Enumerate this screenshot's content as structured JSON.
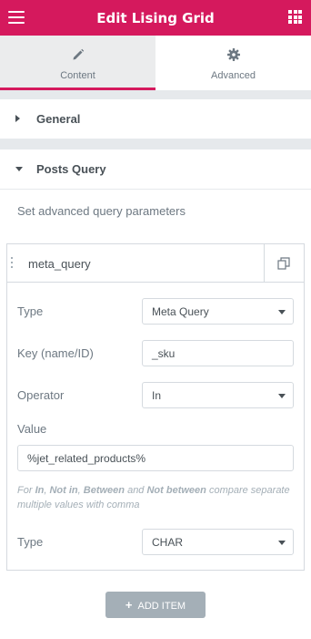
{
  "header": {
    "title": "Edit Lising Grid",
    "menu_icon": "hamburger-menu-icon",
    "apps_icon": "grid-apps-icon",
    "accent_color": "#d5195d"
  },
  "tabs": [
    {
      "label": "Content",
      "icon": "pencil-icon",
      "active": true
    },
    {
      "label": "Advanced",
      "icon": "gear-icon",
      "active": false
    }
  ],
  "sections": {
    "general": {
      "label": "General",
      "expanded": false
    },
    "posts_query": {
      "label": "Posts Query",
      "expanded": true
    }
  },
  "description": "Set advanced query parameters",
  "repeater_item": {
    "title": "meta_query",
    "fields": {
      "type": {
        "label": "Type",
        "value": "Meta Query"
      },
      "key": {
        "label": "Key (name/ID)",
        "value": "_sku"
      },
      "operator": {
        "label": "Operator",
        "value": "In"
      },
      "value": {
        "label": "Value",
        "value": "%jet_related_products%"
      },
      "hint": {
        "prefix": "For ",
        "in": "In",
        "sep1": ", ",
        "not_in": "Not in",
        "sep2": ", ",
        "between": "Between",
        "and": " and ",
        "not_between": "Not between",
        "suffix": " compare separate multiple values with comma"
      },
      "value_type": {
        "label": "Type",
        "value": "CHAR"
      }
    }
  },
  "add_button": {
    "label": "ADD ITEM",
    "plus": "+"
  }
}
